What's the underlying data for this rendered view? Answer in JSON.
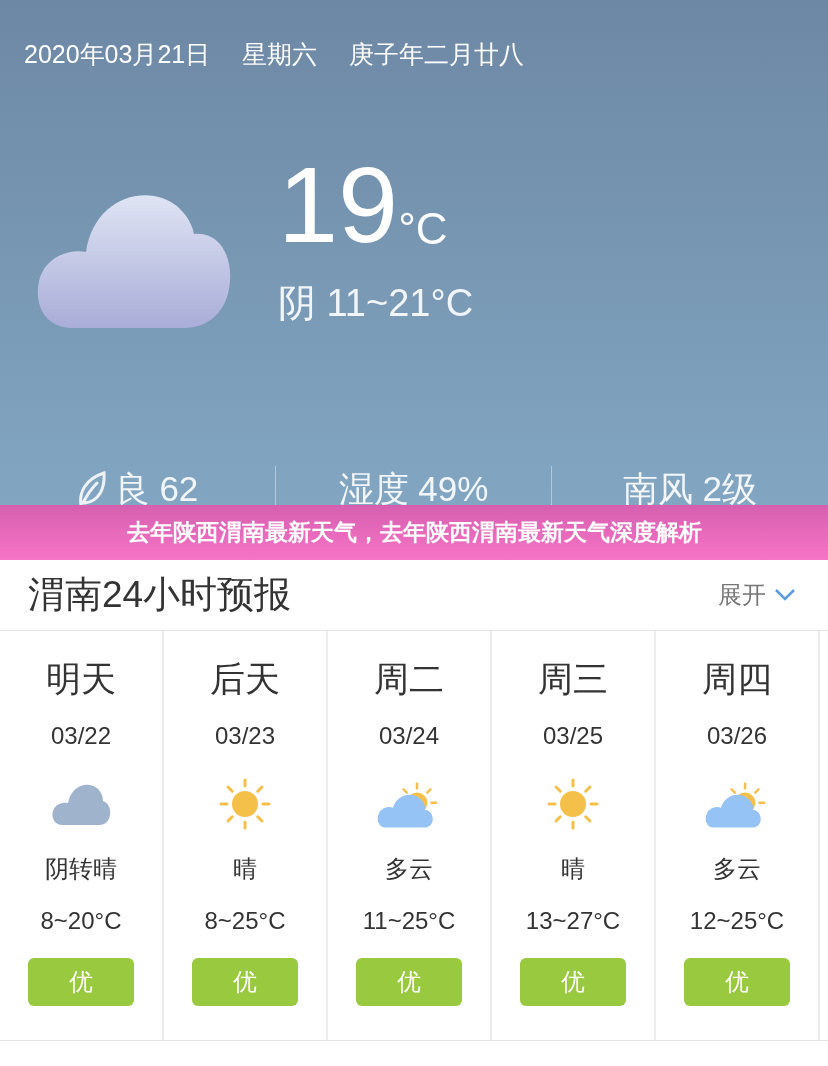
{
  "header": {
    "date": "2020年03月21日",
    "weekday": "星期六",
    "lunar_date": "庚子年二月廿八"
  },
  "current": {
    "kind": "cloudy",
    "temperature": "19",
    "unit": "°C",
    "summary": "阴 11~21°C"
  },
  "stats": [
    {
      "kind": "air",
      "text": "良 62"
    },
    {
      "kind": "plain",
      "text": "湿度 49%"
    },
    {
      "kind": "plain",
      "text": "南风 2级"
    }
  ],
  "banner": {
    "title": "去年陕西渭南最新天气，去年陕西渭南最新天气深度解析"
  },
  "forecast": {
    "title": "渭南24小时预报",
    "expand": "展开",
    "days": [
      {
        "kind": "cloudy",
        "day": "明天",
        "date": "03/22",
        "condition": "阴转晴",
        "range": "8~20°C",
        "quality": "优",
        "color": "#98c93f"
      },
      {
        "kind": "sunny",
        "day": "后天",
        "date": "03/23",
        "condition": "晴",
        "range": "8~25°C",
        "quality": "优",
        "color": "#98c93f"
      },
      {
        "kind": "partly",
        "day": "周二",
        "date": "03/24",
        "condition": "多云",
        "range": "11~25°C",
        "quality": "优",
        "color": "#98c93f"
      },
      {
        "kind": "sunny",
        "day": "周三",
        "date": "03/25",
        "condition": "晴",
        "range": "13~27°C",
        "quality": "优",
        "color": "#98c93f"
      },
      {
        "kind": "partly",
        "day": "周四",
        "date": "03/26",
        "condition": "多云",
        "range": "12~25°C",
        "quality": "优",
        "color": "#98c93f"
      }
    ]
  }
}
